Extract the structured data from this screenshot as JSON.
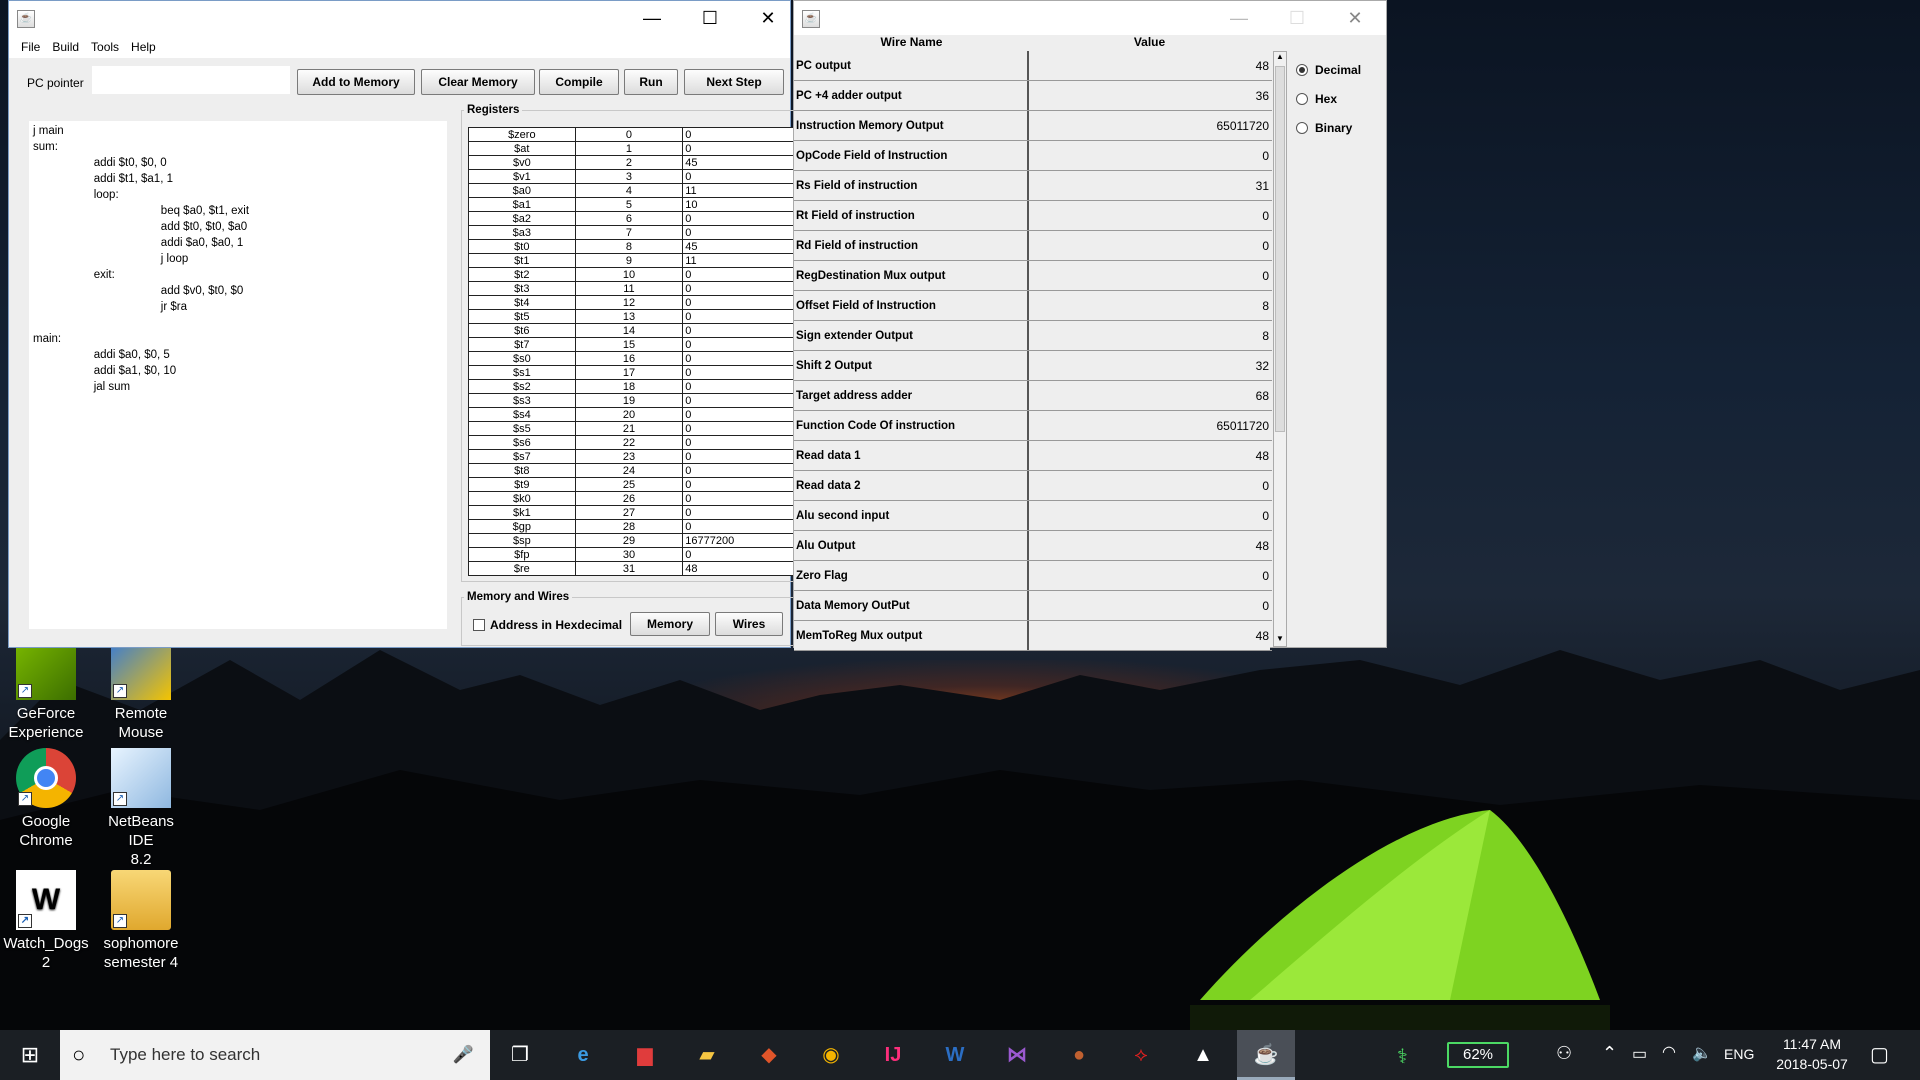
{
  "editor_window": {
    "menu": [
      "File",
      "Build",
      "Tools",
      "Help"
    ],
    "pc_pointer_label": "PC pointer",
    "pc_pointer_value": "",
    "buttons": {
      "add_to_memory": "Add to Memory",
      "clear_memory": "Clear Memory",
      "compile": "Compile",
      "run": "Run",
      "next_step": "Next Step"
    },
    "code_lines": [
      "j main",
      "sum:",
      "                   addi $t0, $0, 0",
      "                   addi $t1, $a1, 1",
      "                   loop:",
      "                                        beq $a0, $t1, exit",
      "                                        add $t0, $t0, $a0",
      "                                        addi $a0, $a0, 1",
      "                                        j loop",
      "                   exit:",
      "                                        add $v0, $t0, $0",
      "                                        jr $ra",
      "",
      "main:",
      "                   addi $a0, $0, 5",
      "                   addi $a1, $0, 10",
      "                   jal sum"
    ],
    "registers_title": "Registers",
    "registers": [
      [
        "$zero",
        "0",
        "0"
      ],
      [
        "$at",
        "1",
        "0"
      ],
      [
        "$v0",
        "2",
        "45"
      ],
      [
        "$v1",
        "3",
        "0"
      ],
      [
        "$a0",
        "4",
        "11"
      ],
      [
        "$a1",
        "5",
        "10"
      ],
      [
        "$a2",
        "6",
        "0"
      ],
      [
        "$a3",
        "7",
        "0"
      ],
      [
        "$t0",
        "8",
        "45"
      ],
      [
        "$t1",
        "9",
        "11"
      ],
      [
        "$t2",
        "10",
        "0"
      ],
      [
        "$t3",
        "11",
        "0"
      ],
      [
        "$t4",
        "12",
        "0"
      ],
      [
        "$t5",
        "13",
        "0"
      ],
      [
        "$t6",
        "14",
        "0"
      ],
      [
        "$t7",
        "15",
        "0"
      ],
      [
        "$s0",
        "16",
        "0"
      ],
      [
        "$s1",
        "17",
        "0"
      ],
      [
        "$s2",
        "18",
        "0"
      ],
      [
        "$s3",
        "19",
        "0"
      ],
      [
        "$s4",
        "20",
        "0"
      ],
      [
        "$s5",
        "21",
        "0"
      ],
      [
        "$s6",
        "22",
        "0"
      ],
      [
        "$s7",
        "23",
        "0"
      ],
      [
        "$t8",
        "24",
        "0"
      ],
      [
        "$t9",
        "25",
        "0"
      ],
      [
        "$k0",
        "26",
        "0"
      ],
      [
        "$k1",
        "27",
        "0"
      ],
      [
        "$gp",
        "28",
        "0"
      ],
      [
        "$sp",
        "29",
        "16777200"
      ],
      [
        "$fp",
        "30",
        "0"
      ],
      [
        "$re",
        "31",
        "48"
      ]
    ],
    "memory_wires_title": "Memory and Wires",
    "address_hex_label": "Address in Hexdecimal",
    "memory_button": "Memory",
    "wires_button": "Wires"
  },
  "wires_window": {
    "col_name": "Wire Name",
    "col_value": "Value",
    "rows": [
      [
        "PC output",
        "48"
      ],
      [
        "PC +4 adder output",
        "36"
      ],
      [
        "Instruction Memory Output",
        "65011720"
      ],
      [
        "OpCode Field of Instruction",
        "0"
      ],
      [
        "Rs Field of instruction",
        "31"
      ],
      [
        "Rt Field of instruction",
        "0"
      ],
      [
        "Rd Field of instruction",
        "0"
      ],
      [
        "RegDestination Mux output",
        "0"
      ],
      [
        "Offset Field of Instruction",
        "8"
      ],
      [
        "Sign extender Output",
        "8"
      ],
      [
        "Shift 2 Output",
        "32"
      ],
      [
        "Target address adder",
        "68"
      ],
      [
        "Function Code Of instruction",
        "65011720"
      ],
      [
        "Read data 1",
        "48"
      ],
      [
        "Read data 2",
        "0"
      ],
      [
        "Alu second input",
        "0"
      ],
      [
        "Alu Output",
        "48"
      ],
      [
        "Zero Flag",
        "0"
      ],
      [
        "Data Memory OutPut",
        "0"
      ],
      [
        "MemToReg Mux output",
        "48"
      ]
    ],
    "radio_options": [
      "Decimal",
      "Hex",
      "Binary"
    ],
    "radio_selected": "Decimal"
  },
  "desktop_icons": [
    {
      "label1": "GeForce",
      "label2": "Experience"
    },
    {
      "label1": "Remote",
      "label2": "Mouse"
    },
    {
      "label1": "Google",
      "label2": "Chrome"
    },
    {
      "label1": "NetBeans IDE",
      "label2": "8.2"
    },
    {
      "label1": "Watch_Dogs",
      "label2": "2"
    },
    {
      "label1": "sophomore",
      "label2": "semester 4"
    }
  ],
  "taskbar": {
    "search_placeholder": "Type here to search",
    "battery": "62%",
    "language": "ENG",
    "time": "11:47 AM",
    "date": "2018-05-07"
  }
}
